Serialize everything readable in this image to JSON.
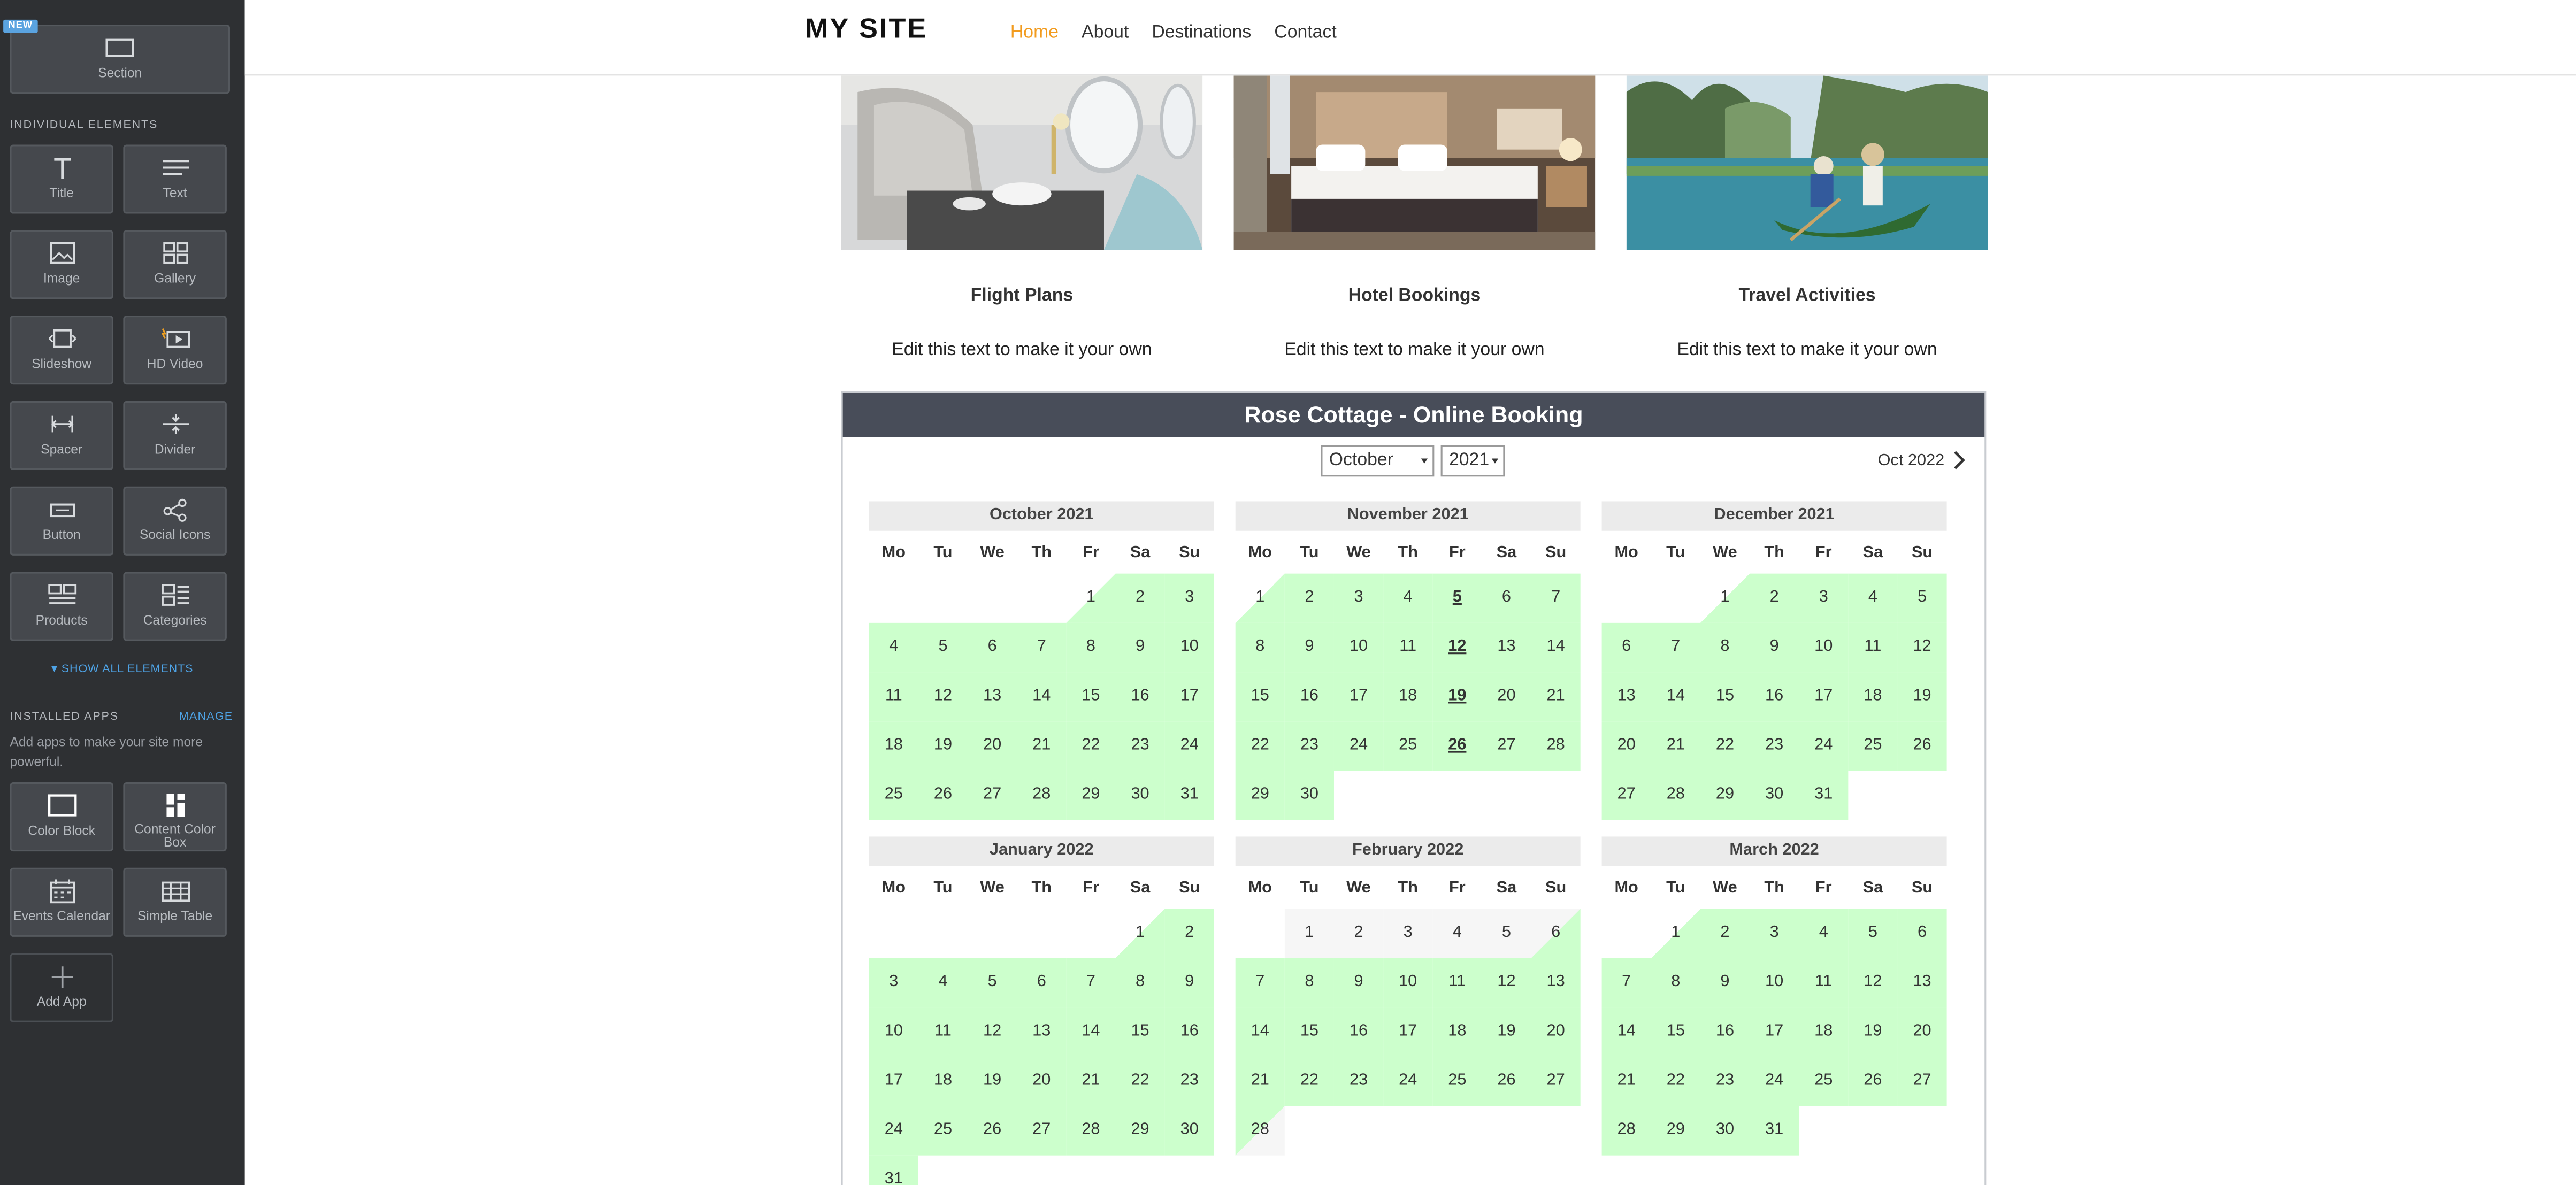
{
  "sidebar": {
    "new_badge": "NEW",
    "section_tile": {
      "label": "Section",
      "icon": "section-icon"
    },
    "individual_heading": "INDIVIDUAL ELEMENTS",
    "elements": [
      {
        "label": "Title",
        "icon": "title-icon"
      },
      {
        "label": "Text",
        "icon": "text-icon"
      },
      {
        "label": "Image",
        "icon": "image-icon"
      },
      {
        "label": "Gallery",
        "icon": "gallery-icon"
      },
      {
        "label": "Slideshow",
        "icon": "slideshow-icon"
      },
      {
        "label": "HD Video",
        "icon": "video-icon"
      },
      {
        "label": "Spacer",
        "icon": "spacer-icon"
      },
      {
        "label": "Divider",
        "icon": "divider-icon"
      },
      {
        "label": "Button",
        "icon": "button-icon"
      },
      {
        "label": "Social Icons",
        "icon": "share-icon"
      },
      {
        "label": "Products",
        "icon": "products-icon"
      },
      {
        "label": "Categories",
        "icon": "categories-icon"
      }
    ],
    "show_all": "SHOW ALL ELEMENTS",
    "installed_heading": "INSTALLED APPS",
    "manage": "MANAGE",
    "installed_desc": "Add apps to make your site more powerful.",
    "apps": [
      {
        "label": "Color Block",
        "icon": "color-block-icon"
      },
      {
        "label": "Content Color Box",
        "icon": "content-box-icon"
      },
      {
        "label": "Events Calendar",
        "icon": "calendar-icon"
      },
      {
        "label": "Simple Table",
        "icon": "table-icon"
      }
    ],
    "add_app": "Add App"
  },
  "header": {
    "logo": "MY SITE",
    "nav": [
      "Home",
      "About",
      "Destinations",
      "Contact"
    ],
    "active_nav": "Home",
    "accent": "#f29b1e"
  },
  "features": [
    {
      "title": "Flight Plans",
      "text": "Edit this text to make it your own"
    },
    {
      "title": "Hotel Bookings",
      "text": "Edit this text to make it your own"
    },
    {
      "title": "Travel Activities",
      "text": "Edit this text to make it your own"
    }
  ],
  "booking": {
    "title": "Rose Cottage - Online Booking",
    "month_select": "October",
    "year_select": "2021",
    "next_label": "Oct 2022",
    "weekdays": [
      "Mo",
      "Tu",
      "We",
      "Th",
      "Fr",
      "Sa",
      "Su"
    ],
    "available_color": "#ccffcc",
    "unavailable_color": "#f6f6f6",
    "months": [
      {
        "title": "October 2021",
        "offset": 4,
        "days": 31,
        "available": [
          [
            1,
            31
          ]
        ],
        "special": []
      },
      {
        "title": "November 2021",
        "offset": 0,
        "days": 30,
        "available": [
          [
            1,
            30
          ]
        ],
        "special": [
          5,
          12,
          19,
          26
        ]
      },
      {
        "title": "December 2021",
        "offset": 2,
        "days": 31,
        "available": [
          [
            1,
            31
          ]
        ],
        "special": []
      },
      {
        "title": "January 2022",
        "offset": 5,
        "days": 31,
        "available": [
          [
            1,
            31
          ]
        ],
        "special": []
      },
      {
        "title": "February 2022",
        "offset": 1,
        "days": 28,
        "available": [
          [
            6,
            27
          ]
        ],
        "special": []
      },
      {
        "title": "March 2022",
        "offset": 1,
        "days": 31,
        "available": [
          [
            1,
            31
          ]
        ],
        "special": []
      }
    ]
  }
}
